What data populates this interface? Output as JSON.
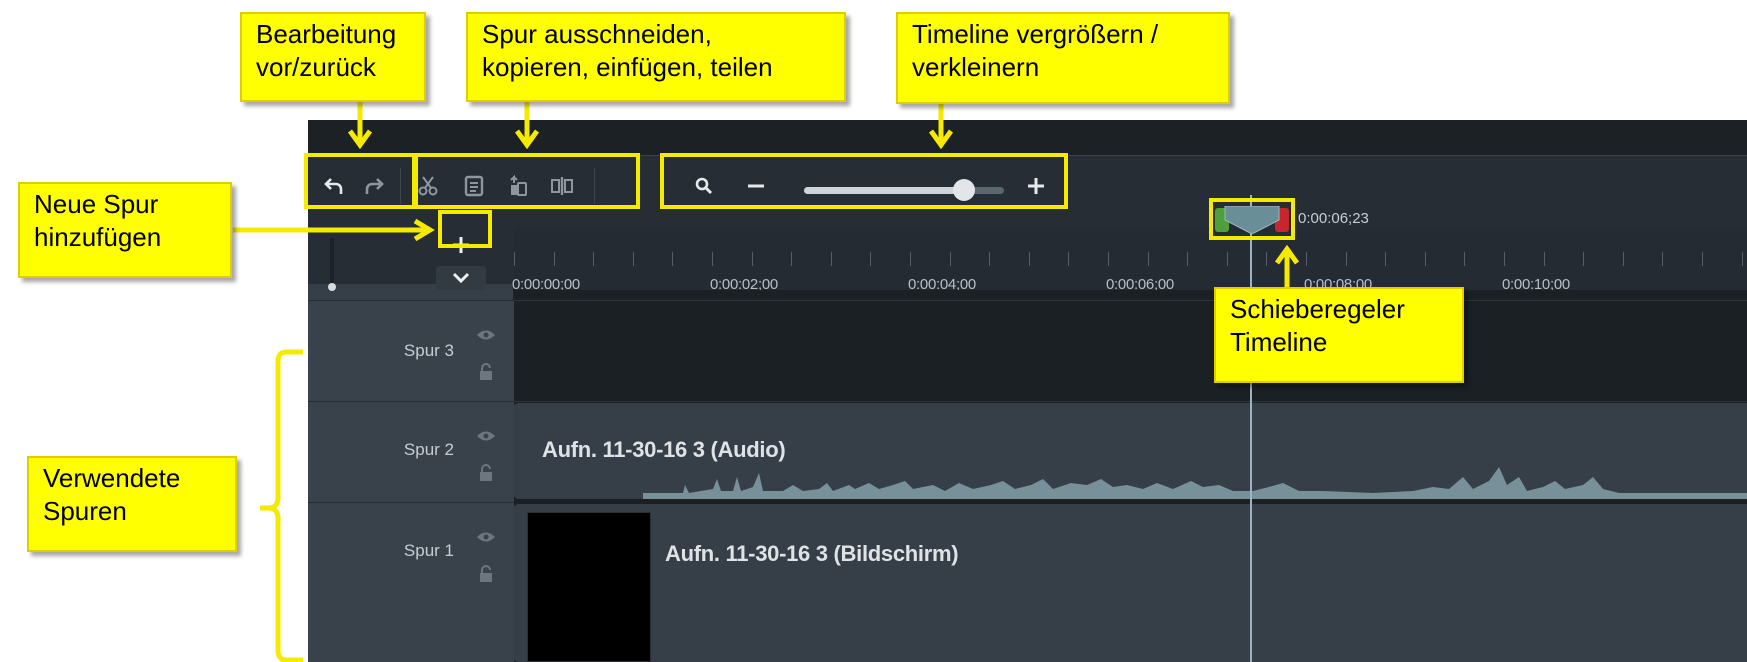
{
  "callouts": {
    "undo_redo": "Bearbeitung\nvor/zurück",
    "cut_copy": "Spur ausschneiden,\nkopieren, einfügen, teilen",
    "zoom": "Timeline vergrößern /\nverkleinern",
    "add_track": "Neue Spur\nhinzufügen",
    "used_tracks": "Verwendete\nSpuren",
    "playhead": "Schieberegeler\nTimeline"
  },
  "toolbar": {
    "icons": [
      "undo-icon",
      "redo-icon",
      "cut-icon",
      "copy-icon",
      "paste-icon",
      "split-icon",
      "search-icon",
      "zoom-out-icon",
      "zoom-in-icon"
    ],
    "zoom_level": 0.8
  },
  "ruler": {
    "labels": [
      "0:00:00;00",
      "0:00:02;00",
      "0:00:04;00",
      "0:00:06;00",
      "0:00:08;00",
      "0:00:10;00"
    ]
  },
  "playhead": {
    "time": "0:00:06;23"
  },
  "tracks": [
    {
      "name": "Spur 3",
      "clip": ""
    },
    {
      "name": "Spur 2",
      "clip": "Aufn. 11-30-16 3 (Audio)"
    },
    {
      "name": "Spur 1",
      "clip": "Aufn. 11-30-16 3 (Bildschirm)"
    }
  ],
  "colors": {
    "callout": "#ffff00",
    "highlight": "#f5ea00",
    "playhead": "#5f8a93",
    "panel": "#262d34"
  }
}
